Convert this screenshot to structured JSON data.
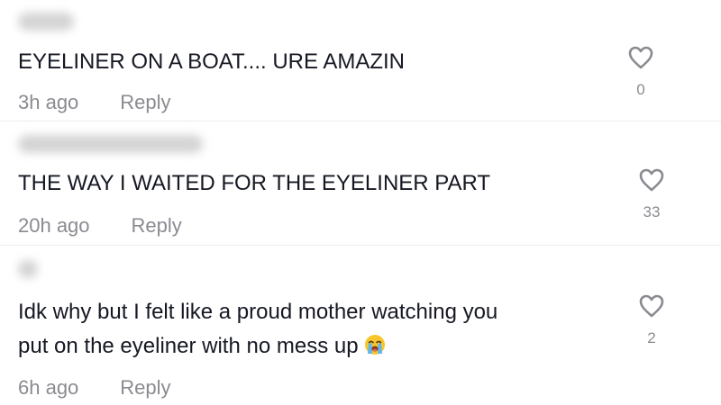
{
  "comments": [
    {
      "text": "EYELINER ON A BOAT.... URE AMAZIN",
      "time": "3h ago",
      "reply_label": "Reply",
      "likes": "0"
    },
    {
      "text": "THE WAY I WAITED FOR THE EYELINER PART",
      "time": "20h ago",
      "reply_label": "Reply",
      "likes": "33"
    },
    {
      "text_line1": "Idk why but I felt like a proud mother watching you",
      "text_line2": "put on the eyeliner with no mess up",
      "time": "6h ago",
      "reply_label": "Reply",
      "likes": "2"
    }
  ],
  "icons": {
    "like": "heart-outline-icon",
    "emoji": "loudly-crying-face-emoji"
  },
  "colors": {
    "text": "#161823",
    "meta": "#8a8b91",
    "icon_stroke": "#8a8b91"
  }
}
